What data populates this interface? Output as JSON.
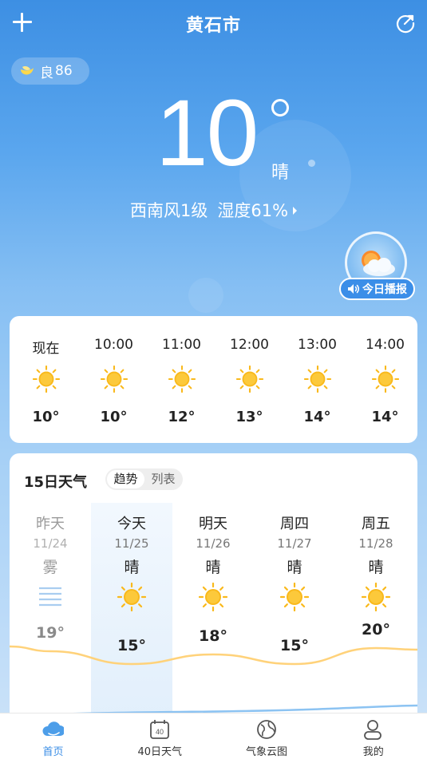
{
  "header": {
    "city": "黄石市"
  },
  "aqi": {
    "label": "良",
    "value": "86"
  },
  "current": {
    "temp": "10",
    "condition": "晴",
    "wind": "西南风1级",
    "humidity": "湿度61%"
  },
  "broadcast": {
    "label": "今日播报"
  },
  "hourly": [
    {
      "time": "现在",
      "icon": "sun-icon",
      "temp": "10°"
    },
    {
      "time": "10:00",
      "icon": "sun-icon",
      "temp": "10°"
    },
    {
      "time": "11:00",
      "icon": "sun-icon",
      "temp": "12°"
    },
    {
      "time": "12:00",
      "icon": "sun-icon",
      "temp": "13°"
    },
    {
      "time": "13:00",
      "icon": "sun-icon",
      "temp": "14°"
    },
    {
      "time": "14:00",
      "icon": "sun-icon",
      "temp": "14°"
    }
  ],
  "daily": {
    "title": "15日天气",
    "toggle_trend": "趋势",
    "toggle_list": "列表",
    "days": [
      {
        "weekday": "昨天",
        "date": "11/24",
        "cond": "雾",
        "icon": "fog-icon",
        "high": "19°"
      },
      {
        "weekday": "今天",
        "date": "11/25",
        "cond": "晴",
        "icon": "sun-icon",
        "high": "15°"
      },
      {
        "weekday": "明天",
        "date": "11/26",
        "cond": "晴",
        "icon": "sun-icon",
        "high": "18°"
      },
      {
        "weekday": "周四",
        "date": "11/27",
        "cond": "晴",
        "icon": "sun-icon",
        "high": "15°"
      },
      {
        "weekday": "周五",
        "date": "11/28",
        "cond": "晴",
        "icon": "sun-icon",
        "high": "20°"
      }
    ]
  },
  "nav": [
    {
      "label": "首页",
      "icon": "home-cloud-icon",
      "active": true
    },
    {
      "label": "40日天气",
      "icon": "calendar-40-icon",
      "active": false
    },
    {
      "label": "气象云图",
      "icon": "globe-icon",
      "active": false
    },
    {
      "label": "我的",
      "icon": "user-icon",
      "active": false
    }
  ],
  "colors": {
    "accent": "#3a8de6",
    "sun": "#f9b91c",
    "curve": "#ffd27a"
  }
}
